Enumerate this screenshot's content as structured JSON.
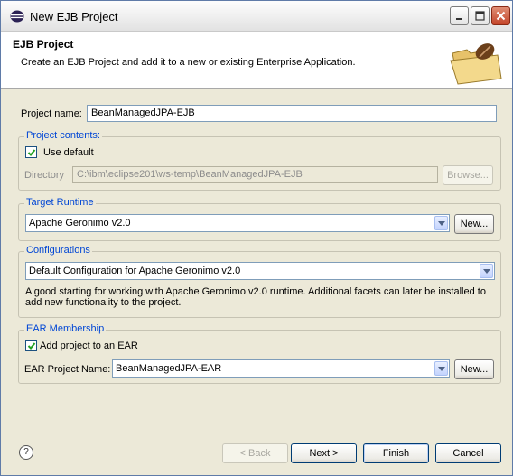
{
  "window": {
    "title": "New EJB Project"
  },
  "header": {
    "title": "EJB Project",
    "description": "Create an EJB Project and add it to a new or existing Enterprise Application."
  },
  "project_name": {
    "label": "Project name:",
    "value": "BeanManagedJPA-EJB"
  },
  "project_contents": {
    "title": "Project contents:",
    "use_default_label": "Use default",
    "use_default_checked": true,
    "directory_label": "Directory",
    "directory_value": "C:\\ibm\\eclipse201\\ws-temp\\BeanManagedJPA-EJB",
    "browse_label": "Browse..."
  },
  "target_runtime": {
    "title": "Target Runtime",
    "selected": "Apache Geronimo v2.0",
    "new_label": "New..."
  },
  "configurations": {
    "title": "Configurations",
    "selected": "Default Configuration for Apache Geronimo v2.0",
    "description_line1": "A good starting for working with Apache Geronimo v2.0 runtime. Additional facets can later be installed to",
    "description_line2": "add new functionality to the project."
  },
  "ear_membership": {
    "title": "EAR Membership",
    "add_label": "Add project to an EAR",
    "add_checked": true,
    "ear_name_label": "EAR Project Name:",
    "ear_name_value": "BeanManagedJPA-EAR",
    "new_label": "New..."
  },
  "footer": {
    "back_label": "< Back",
    "next_label": "Next >",
    "finish_label": "Finish",
    "cancel_label": "Cancel",
    "help_glyph": "?"
  },
  "icons": [
    "eclipse-icon",
    "minimize-icon",
    "maximize-icon",
    "close-icon",
    "folder-bean-icon",
    "checkmark-icon",
    "dropdown-arrow-icon",
    "help-icon"
  ]
}
